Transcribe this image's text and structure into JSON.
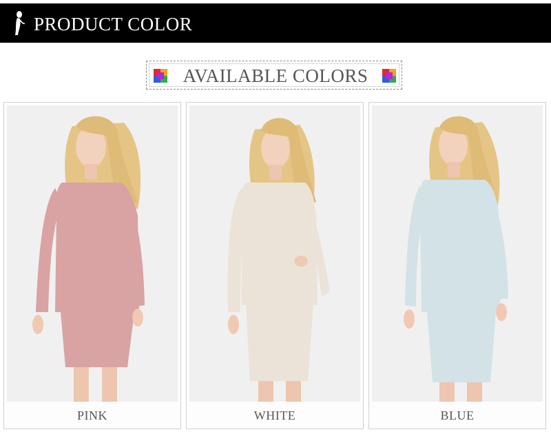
{
  "header": {
    "title": "PRODUCT COLOR",
    "logo_icon": "silhouette-logo-icon"
  },
  "section": {
    "title": "AVAILABLE COLORS",
    "icons": [
      "color-swatch-icon",
      "color-swatch-icon"
    ]
  },
  "colors": [
    {
      "label": "PINK",
      "dress_color": "#d9a2a3"
    },
    {
      "label": "WHITE",
      "dress_color": "#ece3d8"
    },
    {
      "label": "BLUE",
      "dress_color": "#d2e2e6"
    }
  ],
  "theme": {
    "header_bg": "#000000",
    "header_text": "#ffffff",
    "label_text": "#555555"
  }
}
